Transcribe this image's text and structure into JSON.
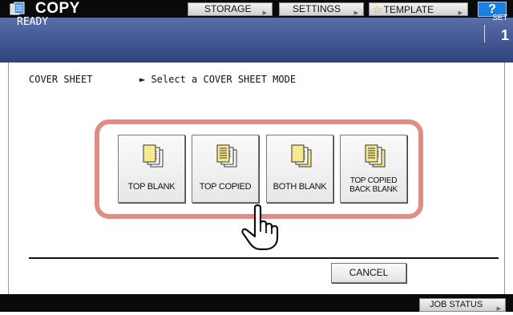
{
  "app": {
    "title": "COPY",
    "icon": "copy-app-icon"
  },
  "toolbar": {
    "storage_label": "STORAGE",
    "settings_label": "SETTINGS",
    "template_label": "TEMPLATE",
    "help_label": "?"
  },
  "status": {
    "text": "READY",
    "set_label": "SET",
    "set_value": "1"
  },
  "main": {
    "section_label": "COVER SHEET",
    "instruction": "► Select a COVER SHEET MODE",
    "modes": [
      {
        "label": "TOP BLANK",
        "icon": "top-blank-pages-icon"
      },
      {
        "label": "TOP COPIED",
        "icon": "top-copied-pages-icon"
      },
      {
        "label": "BOTH BLANK",
        "icon": "both-blank-pages-icon"
      },
      {
        "label_line1": "TOP COPIED",
        "label_line2": "BACK BLANK",
        "icon": "top-copied-back-blank-pages-icon"
      }
    ],
    "cancel_label": "CANCEL"
  },
  "footer": {
    "job_status_label": "JOB STATUS"
  },
  "colors": {
    "status_bar_top": "#5a6eaa",
    "status_bar_bottom": "#2f437e",
    "highlight_frame": "#e08d84",
    "help_blue": "#1c7fe0",
    "page_yellow": "#f5ea8c"
  }
}
